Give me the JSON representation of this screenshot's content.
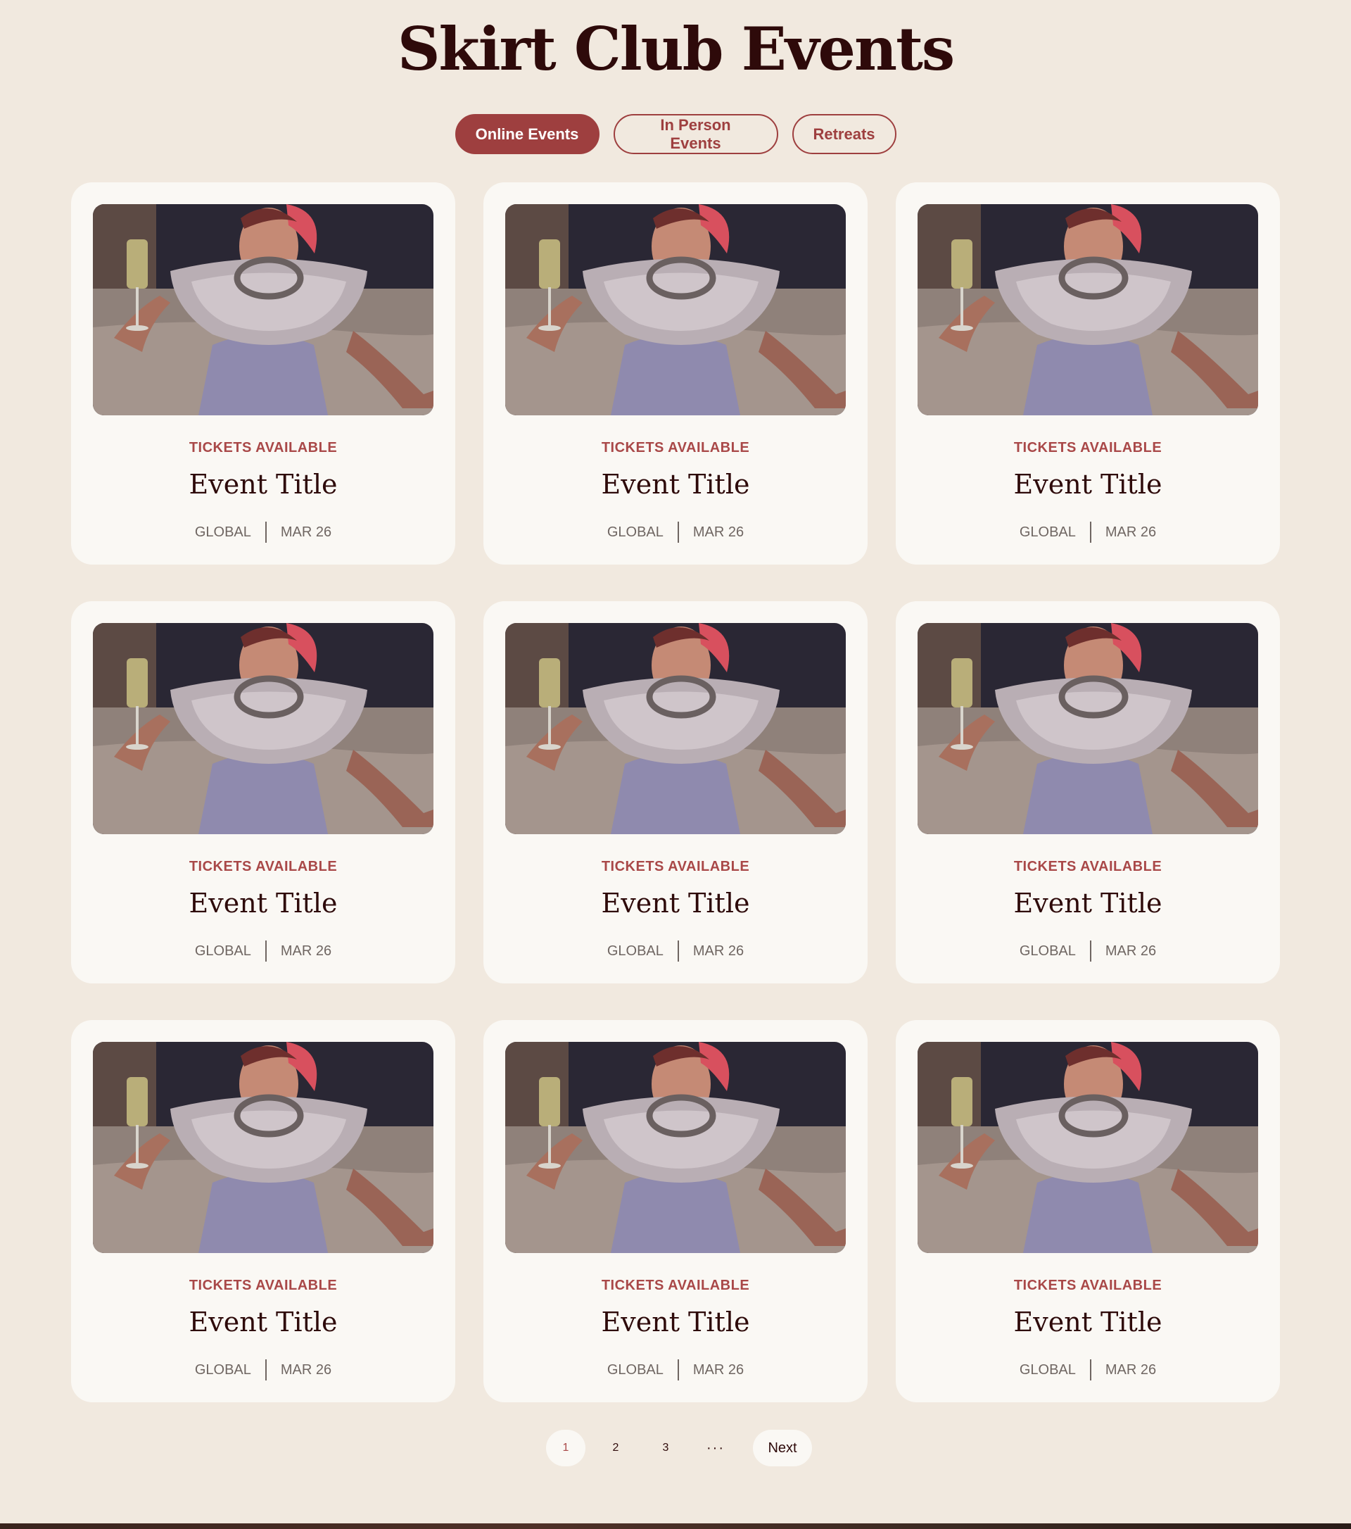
{
  "page": {
    "title": "Skirt Club Events"
  },
  "filters": [
    {
      "label": "Online Events",
      "active": true
    },
    {
      "label": "In Person Events",
      "active": false
    },
    {
      "label": "Retreats",
      "active": false
    }
  ],
  "events": [
    {
      "status": "TICKETS AVAILABLE",
      "title": "Event Title",
      "location": "GLOBAL",
      "date": "MAR 26"
    },
    {
      "status": "TICKETS AVAILABLE",
      "title": "Event Title",
      "location": "GLOBAL",
      "date": "MAR 26"
    },
    {
      "status": "TICKETS AVAILABLE",
      "title": "Event Title",
      "location": "GLOBAL",
      "date": "MAR 26"
    },
    {
      "status": "TICKETS AVAILABLE",
      "title": "Event Title",
      "location": "GLOBAL",
      "date": "MAR 26"
    },
    {
      "status": "TICKETS AVAILABLE",
      "title": "Event Title",
      "location": "GLOBAL",
      "date": "MAR 26"
    },
    {
      "status": "TICKETS AVAILABLE",
      "title": "Event Title",
      "location": "GLOBAL",
      "date": "MAR 26"
    },
    {
      "status": "TICKETS AVAILABLE",
      "title": "Event Title",
      "location": "GLOBAL",
      "date": "MAR 26"
    },
    {
      "status": "TICKETS AVAILABLE",
      "title": "Event Title",
      "location": "GLOBAL",
      "date": "MAR 26"
    },
    {
      "status": "TICKETS AVAILABLE",
      "title": "Event Title",
      "location": "GLOBAL",
      "date": "MAR 26"
    }
  ],
  "pagination": {
    "pages": [
      "1",
      "2",
      "3"
    ],
    "current": "1",
    "ellipsis": "···",
    "next_label": "Next"
  },
  "colors": {
    "background": "#f1e9df",
    "card": "#faf8f4",
    "accent": "#9e3f3f",
    "title_text": "#2e0a0a",
    "meta_text": "#6f6662"
  }
}
